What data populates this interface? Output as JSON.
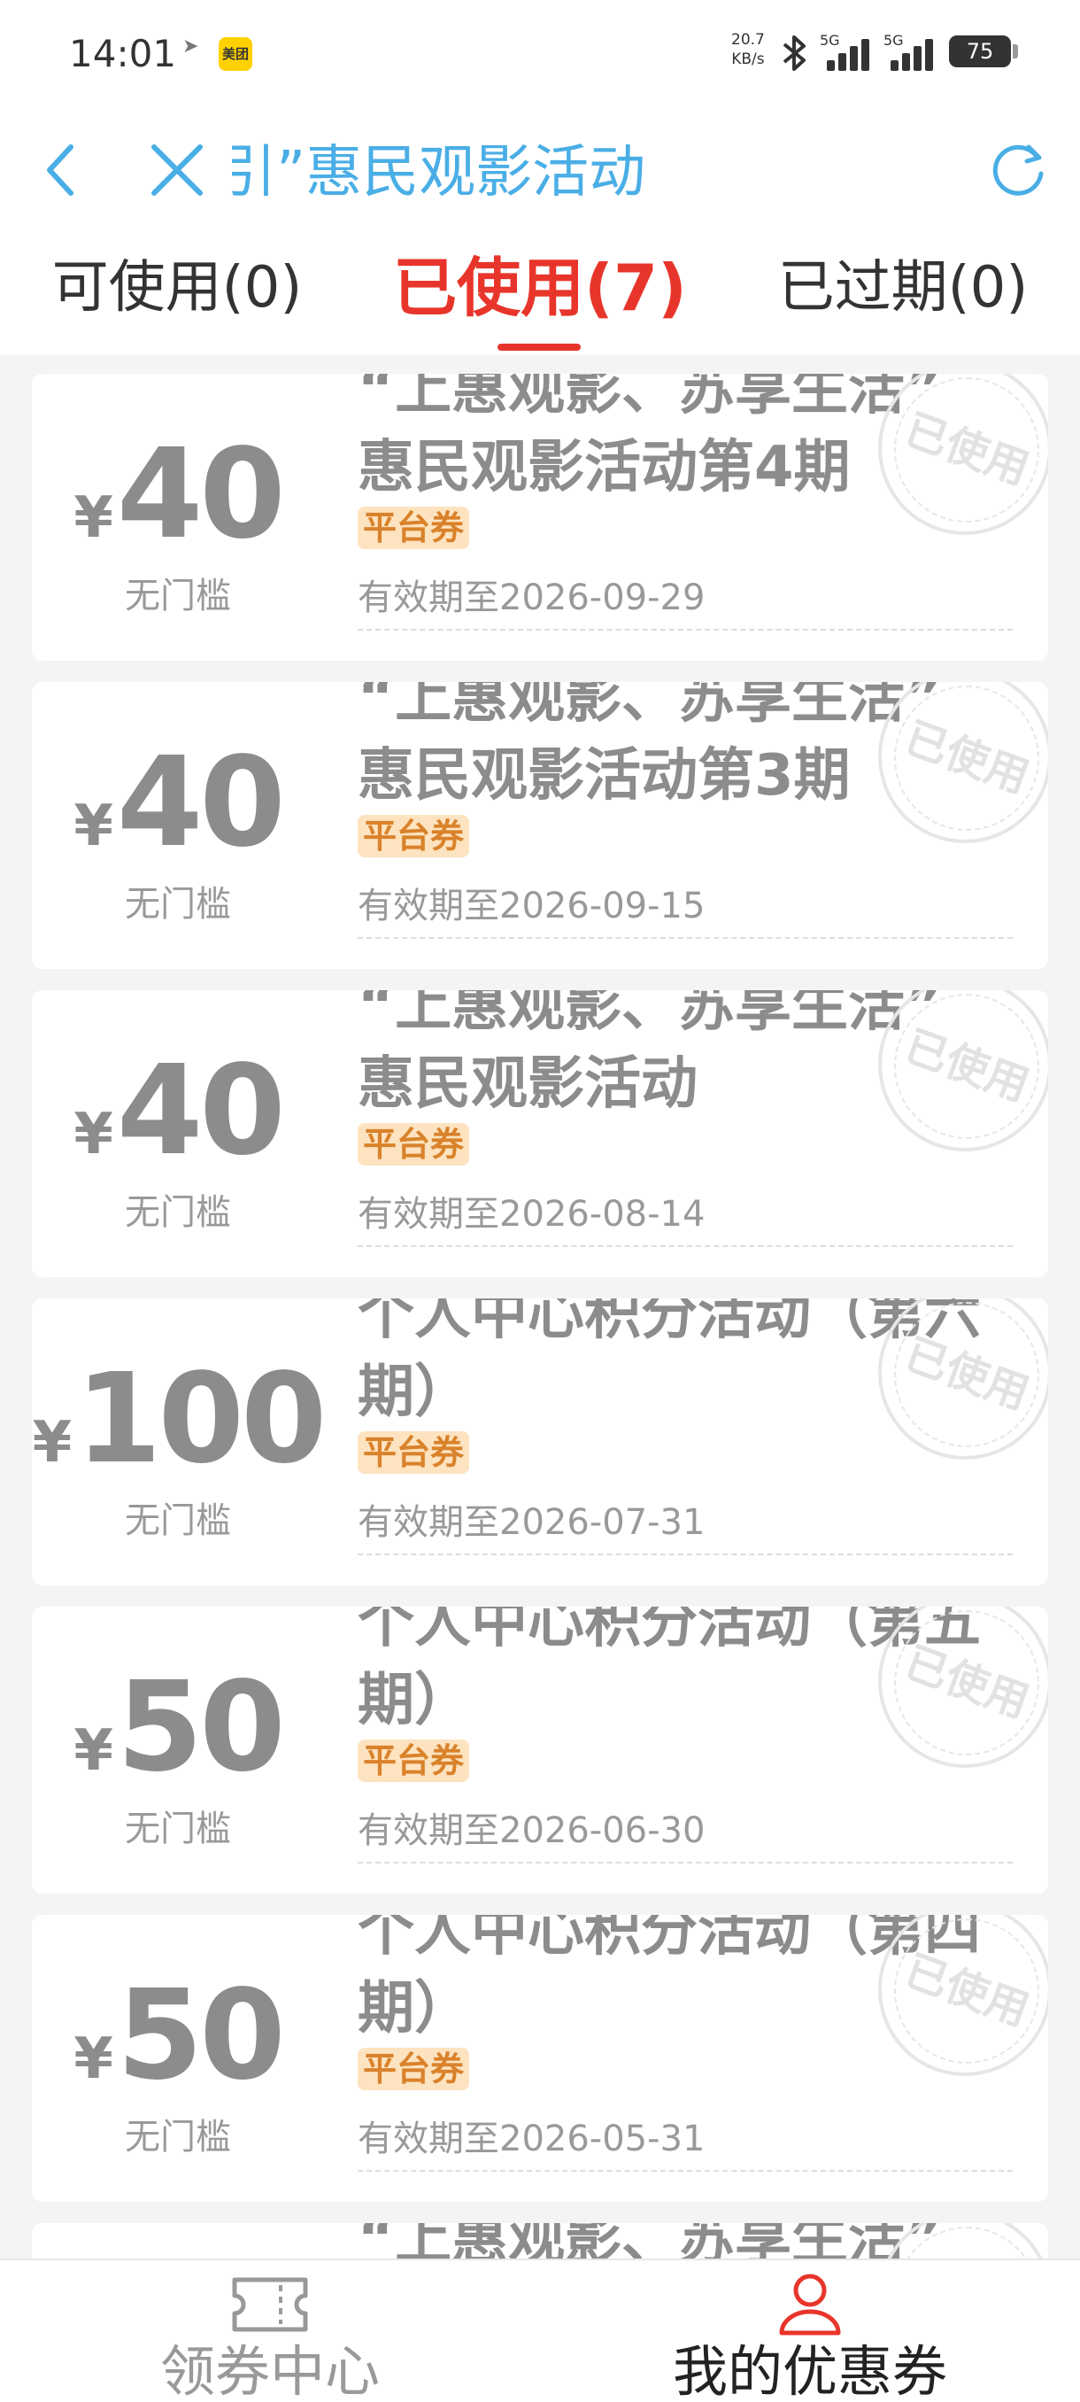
{
  "status_bar": {
    "time": "14:01",
    "app_badge": "美团",
    "net_speed_value": "20.7",
    "net_speed_unit": "KB/s",
    "signal1": "5G",
    "signal2": "5G",
    "battery": "75"
  },
  "nav": {
    "title": "引”惠民观影活动"
  },
  "tabs": [
    {
      "label": "可使用(0)",
      "active": false
    },
    {
      "label": "已使用(7)",
      "active": true
    },
    {
      "label": "已过期(0)",
      "active": false
    }
  ],
  "coupons": [
    {
      "currency": "¥",
      "amount": "40",
      "threshold": "无门槛",
      "clipped_line": "“上惠观影、苏享生活”",
      "name": "惠民观影活动第4期",
      "tag": "平台券",
      "expiry": "有效期至2026-09-29",
      "stamp": "已使用"
    },
    {
      "currency": "¥",
      "amount": "40",
      "threshold": "无门槛",
      "clipped_line": "“上惠观影、苏享生活”",
      "name": "惠民观影活动第3期",
      "tag": "平台券",
      "expiry": "有效期至2026-09-15",
      "stamp": "已使用"
    },
    {
      "currency": "¥",
      "amount": "40",
      "threshold": "无门槛",
      "clipped_line": "“上惠观影、苏享生活”",
      "name": "惠民观影活动",
      "tag": "平台券",
      "expiry": "有效期至2026-08-14",
      "stamp": "已使用"
    },
    {
      "currency": "¥",
      "amount": "100",
      "threshold": "无门槛",
      "clipped_line": "个人中心积分活动（第六",
      "name": "期）",
      "tag": "平台券",
      "expiry": "有效期至2026-07-31",
      "stamp": "已使用"
    },
    {
      "currency": "¥",
      "amount": "50",
      "threshold": "无门槛",
      "clipped_line": "个人中心积分活动（第五",
      "name": "期）",
      "tag": "平台券",
      "expiry": "有效期至2026-06-30",
      "stamp": "已使用"
    },
    {
      "currency": "¥",
      "amount": "50",
      "threshold": "无门槛",
      "clipped_line": "个人中心积分活动（第四",
      "name": "期）",
      "tag": "平台券",
      "expiry": "有效期至2026-05-31",
      "stamp": "已使用"
    },
    {
      "currency": "",
      "amount": "",
      "threshold": "",
      "clipped_line": "“上惠观影、苏享生活”",
      "name": "",
      "tag": "",
      "expiry": "",
      "stamp": ""
    }
  ],
  "bottom_nav": {
    "left_label": "领券中心",
    "right_label": "我的优惠券"
  },
  "colors": {
    "accent_red": "#e8352b",
    "nav_blue": "#4aaee6",
    "tag_bg": "#fde3bf",
    "tag_text": "#d9822b"
  }
}
